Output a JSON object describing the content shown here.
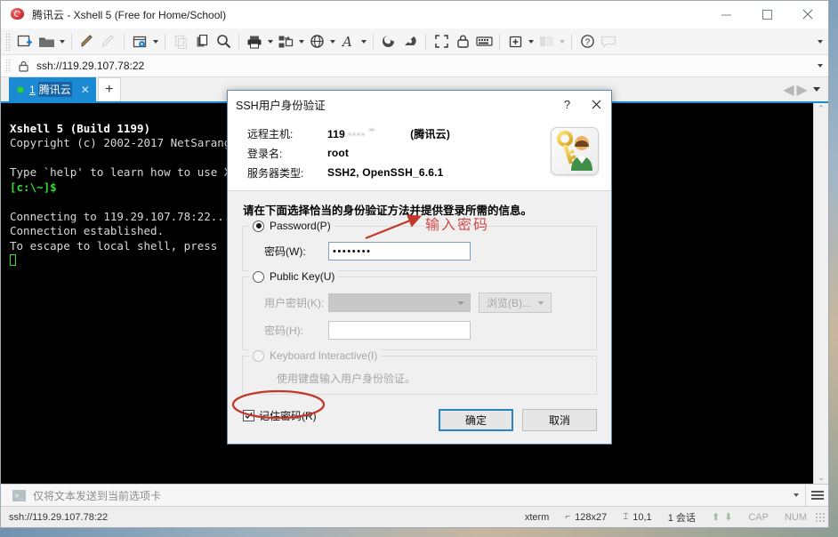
{
  "window": {
    "title": "腾讯云 - Xshell 5 (Free for Home/School)",
    "app_icon": "xshell-icon",
    "minimize_label": "—",
    "maximize_label": "□",
    "close_label": "✕"
  },
  "toolbar": {
    "items": [
      {
        "name": "new-session-icon",
        "glyph": "new"
      },
      {
        "name": "open-folder-icon",
        "glyph": "folder",
        "caret": true
      },
      {
        "name": "edit-session-icon",
        "glyph": "pencil"
      },
      {
        "name": "disconnect-icon",
        "glyph": "pencil-dim",
        "dim": true
      },
      {
        "name": "session-properties-icon",
        "glyph": "gear-window",
        "caret": true
      },
      {
        "name": "cut-icon",
        "glyph": "copy-dim",
        "dim": true
      },
      {
        "name": "paste-icon",
        "glyph": "paste"
      },
      {
        "name": "find-icon",
        "glyph": "search"
      },
      {
        "name": "print-icon",
        "glyph": "printer",
        "caret": true
      },
      {
        "name": "transfer-file-icon",
        "glyph": "transfer",
        "caret": true
      },
      {
        "name": "globe-icon",
        "glyph": "globe",
        "caret": true
      },
      {
        "name": "font-icon",
        "glyph": "font-A",
        "caret": true
      },
      {
        "name": "xftp-icon",
        "glyph": "shell-a"
      },
      {
        "name": "xshell-icon-2",
        "glyph": "shell-b"
      },
      {
        "name": "fullscreen-icon",
        "glyph": "expand"
      },
      {
        "name": "lock-session-icon",
        "glyph": "lock"
      },
      {
        "name": "keyboard-icon",
        "glyph": "keyboard"
      },
      {
        "name": "add-panel-icon",
        "glyph": "add-box",
        "caret": true
      },
      {
        "name": "layout-icon",
        "glyph": "layout-dim",
        "dim": true,
        "caret": true,
        "caret_dim": true
      },
      {
        "name": "help-icon",
        "glyph": "question"
      },
      {
        "name": "comment-icon",
        "glyph": "comment-dim",
        "dim": true
      }
    ],
    "overflow_label": "▾"
  },
  "address_bar": {
    "lock_icon": "lock-icon",
    "url": "ssh://119.29.107.78:22",
    "dropdown_label": "▾"
  },
  "tabs": {
    "items": [
      {
        "number": "1",
        "label": "腾讯云",
        "close_label": "✕",
        "status": "connected"
      }
    ],
    "new_tab_label": "+",
    "nav_prev": "◀",
    "nav_next": "▶",
    "nav_menu": "▾"
  },
  "terminal": {
    "lines": [
      {
        "text": "Xshell 5 (Build 1199)",
        "style": "bold"
      },
      {
        "text": "Copyright (c) 2002-2017 NetSarang C",
        "style": "normal"
      },
      {
        "text": "",
        "style": "normal"
      },
      {
        "text": "Type `help' to learn how to use Xsh",
        "style": "normal"
      },
      {
        "text": "[c:\\~]$",
        "style": "green"
      },
      {
        "text": "",
        "style": "normal"
      },
      {
        "text": "Connecting to 119.29.107.78:22...",
        "style": "normal"
      },
      {
        "text": "Connection established.",
        "style": "normal"
      },
      {
        "text": "To escape to local shell, press 'Ct",
        "style": "normal"
      },
      {
        "text": "",
        "style": "cursor"
      }
    ],
    "scroll_up": "⌃",
    "scroll_down": "⌄"
  },
  "send_to_bar": {
    "icon": "prompt-icon",
    "icon_glyph": ">_",
    "text": "仅将文本发送到当前选项卡",
    "caret_label": "▾",
    "menu_label": "≡"
  },
  "status_bar": {
    "connection": "ssh://119.29.107.78:22",
    "terminal_type": "xterm",
    "size_icon": "resize-icon",
    "size": "128x27",
    "cursor_icon": "cursor-icon",
    "cursor": "10,1",
    "sessions": "1 会话",
    "upload_icon": "arrow-up-icon",
    "download_icon": "arrow-down-icon",
    "caps": "CAP",
    "num": "NUM"
  },
  "dialog": {
    "title": "SSH用户身份验证",
    "help_label": "?",
    "close_label": "✕",
    "key_icon": "key-user-icon",
    "info": [
      {
        "label": "远程主机:",
        "value_prefix": "119",
        "value_blur": "···· ‾",
        "value_suffix": "(腾讯云)"
      },
      {
        "label": "登录名:",
        "value_prefix": "root",
        "value_blur": "",
        "value_suffix": ""
      },
      {
        "label": "服务器类型:",
        "value_prefix": "SSH2, OpenSSH_6.6.1",
        "value_blur": "",
        "value_suffix": ""
      }
    ],
    "instruction": "请在下面选择恰当的身份验证方法并提供登录所需的信息。",
    "password_group": {
      "radio_label": "Password(P)",
      "selected": true,
      "field_label": "密码(W):",
      "field_value": "••••••••"
    },
    "publickey_group": {
      "radio_label": "Public Key(U)",
      "selected": false,
      "key_label": "用户密钥(K):",
      "key_value": "",
      "browse_label": "浏览(B)...",
      "browse_caret": "▾",
      "passphrase_label": "密码(H):",
      "passphrase_value": ""
    },
    "keyboard_group": {
      "radio_label": "Keyboard Interactive(I)",
      "selected": false,
      "description": "使用键盘输入用户身份验证。"
    },
    "remember": {
      "label": "记住密码(R)",
      "checked": true
    },
    "ok_label": "确定",
    "cancel_label": "取消"
  },
  "annotations": {
    "password_hint": "输入密码",
    "hint_color": "#d24a4a",
    "arrow_name": "red-arrow-annotation",
    "ellipse_name": "red-ellipse-annotation"
  }
}
